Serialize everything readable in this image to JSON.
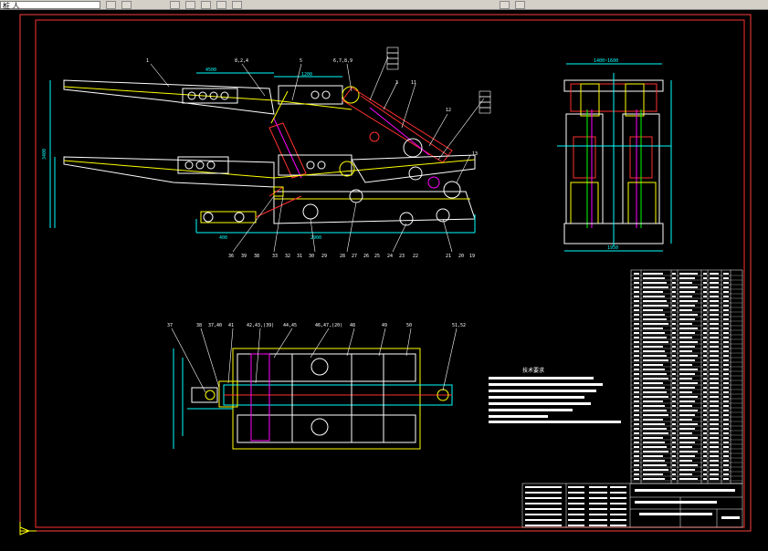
{
  "toolbar": {
    "layer_field": "桩 人",
    "buttons": [
      "save",
      "print",
      "layer-state",
      "refresh",
      "match",
      "color",
      "link",
      "zoom"
    ]
  },
  "drawing": {
    "title": "技术要求",
    "part_labels_top": [
      "1",
      "8,2,4",
      "5",
      "6,7,8,9",
      "3",
      "11",
      "12",
      "13"
    ],
    "part_labels_bottom": [
      "36",
      "39",
      "38",
      "34",
      "33",
      "32",
      "31",
      "30",
      "29",
      "28",
      "27",
      "26",
      "25",
      "24",
      "23",
      "22",
      "21"
    ],
    "plan_labels": [
      "37",
      "38",
      "37,40",
      "41",
      "42,43,(39)",
      "44,45",
      "46,47,(20)",
      "48",
      "49",
      "50",
      "51,52"
    ],
    "colors": {
      "background": "#000000",
      "frame": "#ff0000",
      "outline": "#ffffff",
      "yellow": "#ffff00",
      "cyan": "#00ffff",
      "red": "#ff3030",
      "green": "#00ff00",
      "magenta": "#ff00ff"
    }
  }
}
